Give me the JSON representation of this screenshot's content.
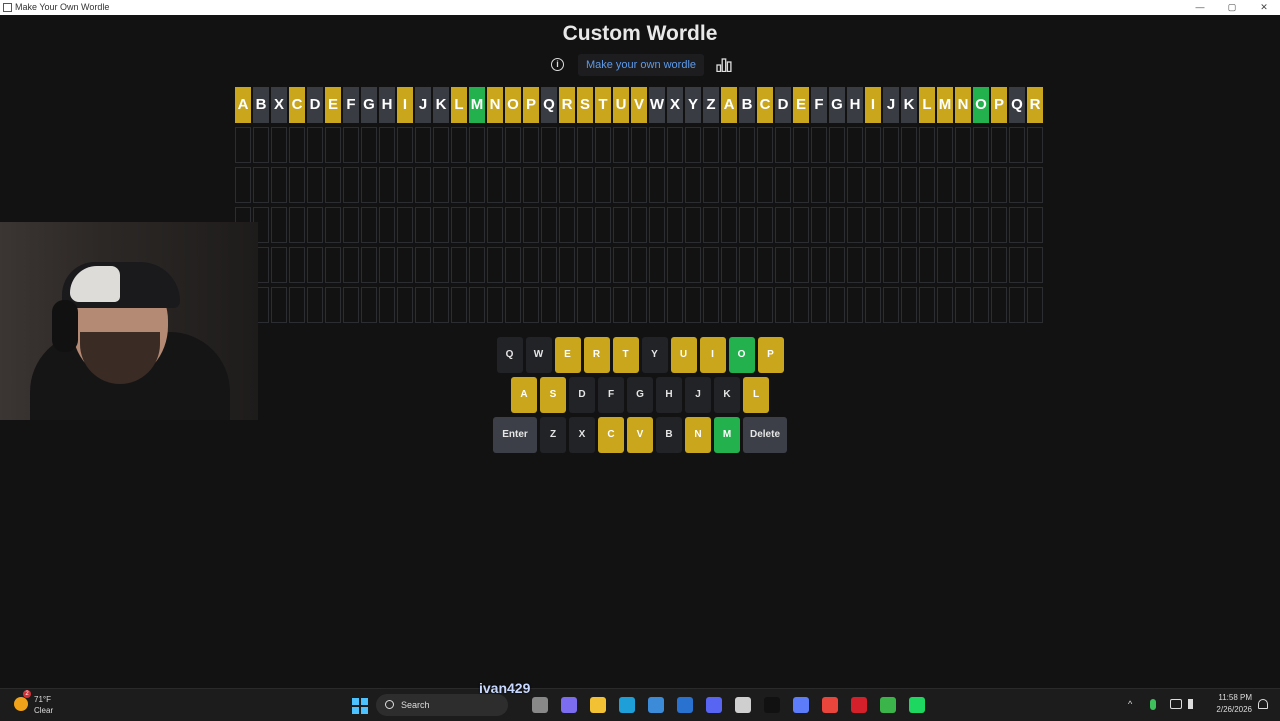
{
  "window": {
    "title": "Make Your Own Wordle",
    "controls": [
      "—",
      "▢",
      "✕"
    ]
  },
  "header": {
    "title": "Custom Wordle",
    "link_label": "Make your own wordle",
    "info_icon": "info-icon",
    "stats_icon": "stats-icon"
  },
  "colors": {
    "correct": "#22b14c",
    "present": "#c9a61c",
    "absent": "#3a3c43",
    "background": "#121213",
    "link": "#5e9ae8"
  },
  "board": {
    "columns": 45,
    "empty_rows": 5,
    "guess_row": [
      {
        "letter": "A",
        "state": "present"
      },
      {
        "letter": "B",
        "state": "absent"
      },
      {
        "letter": "X",
        "state": "absent"
      },
      {
        "letter": "C",
        "state": "present"
      },
      {
        "letter": "D",
        "state": "absent"
      },
      {
        "letter": "E",
        "state": "present"
      },
      {
        "letter": "F",
        "state": "absent"
      },
      {
        "letter": "G",
        "state": "absent"
      },
      {
        "letter": "H",
        "state": "absent"
      },
      {
        "letter": "I",
        "state": "present"
      },
      {
        "letter": "J",
        "state": "absent"
      },
      {
        "letter": "K",
        "state": "absent"
      },
      {
        "letter": "L",
        "state": "present"
      },
      {
        "letter": "M",
        "state": "correct"
      },
      {
        "letter": "N",
        "state": "present"
      },
      {
        "letter": "O",
        "state": "present"
      },
      {
        "letter": "P",
        "state": "present"
      },
      {
        "letter": "Q",
        "state": "absent"
      },
      {
        "letter": "R",
        "state": "present"
      },
      {
        "letter": "S",
        "state": "present"
      },
      {
        "letter": "T",
        "state": "present"
      },
      {
        "letter": "U",
        "state": "present"
      },
      {
        "letter": "V",
        "state": "present"
      },
      {
        "letter": "W",
        "state": "absent"
      },
      {
        "letter": "X",
        "state": "absent"
      },
      {
        "letter": "Y",
        "state": "absent"
      },
      {
        "letter": "Z",
        "state": "absent"
      },
      {
        "letter": "A",
        "state": "present"
      },
      {
        "letter": "B",
        "state": "absent"
      },
      {
        "letter": "C",
        "state": "present"
      },
      {
        "letter": "D",
        "state": "absent"
      },
      {
        "letter": "E",
        "state": "present"
      },
      {
        "letter": "F",
        "state": "absent"
      },
      {
        "letter": "G",
        "state": "absent"
      },
      {
        "letter": "H",
        "state": "absent"
      },
      {
        "letter": "I",
        "state": "present"
      },
      {
        "letter": "J",
        "state": "absent"
      },
      {
        "letter": "K",
        "state": "absent"
      },
      {
        "letter": "L",
        "state": "present"
      },
      {
        "letter": "M",
        "state": "present"
      },
      {
        "letter": "N",
        "state": "present"
      },
      {
        "letter": "O",
        "state": "correct"
      },
      {
        "letter": "P",
        "state": "present"
      },
      {
        "letter": "Q",
        "state": "absent"
      },
      {
        "letter": "R",
        "state": "present"
      }
    ]
  },
  "keyboard": {
    "rows": [
      [
        {
          "key": "Q",
          "state": "default"
        },
        {
          "key": "W",
          "state": "default"
        },
        {
          "key": "E",
          "state": "present"
        },
        {
          "key": "R",
          "state": "present"
        },
        {
          "key": "T",
          "state": "present"
        },
        {
          "key": "Y",
          "state": "default"
        },
        {
          "key": "U",
          "state": "present"
        },
        {
          "key": "I",
          "state": "present"
        },
        {
          "key": "O",
          "state": "correct"
        },
        {
          "key": "P",
          "state": "present"
        }
      ],
      [
        {
          "key": "A",
          "state": "present"
        },
        {
          "key": "S",
          "state": "present"
        },
        {
          "key": "D",
          "state": "default"
        },
        {
          "key": "F",
          "state": "default"
        },
        {
          "key": "G",
          "state": "default"
        },
        {
          "key": "H",
          "state": "default"
        },
        {
          "key": "J",
          "state": "default"
        },
        {
          "key": "K",
          "state": "default"
        },
        {
          "key": "L",
          "state": "present"
        }
      ],
      [
        {
          "key": "Enter",
          "state": "wide"
        },
        {
          "key": "Z",
          "state": "default"
        },
        {
          "key": "X",
          "state": "default"
        },
        {
          "key": "C",
          "state": "present"
        },
        {
          "key": "V",
          "state": "present"
        },
        {
          "key": "B",
          "state": "default"
        },
        {
          "key": "N",
          "state": "present"
        },
        {
          "key": "M",
          "state": "correct"
        },
        {
          "key": "Delete",
          "state": "wide"
        }
      ]
    ]
  },
  "overlay": {
    "username": "ivan429"
  },
  "taskbar": {
    "weather": {
      "temp": "71°F",
      "condition": "Clear",
      "badge": "2"
    },
    "search_label": "Search",
    "apps": [
      {
        "name": "task-view-icon",
        "color": "#888888"
      },
      {
        "name": "copilot-icon",
        "color": "#7b6cf0"
      },
      {
        "name": "file-explorer-icon",
        "color": "#f3c234"
      },
      {
        "name": "edge-icon",
        "color": "#1f9fd8"
      },
      {
        "name": "store-icon",
        "color": "#3c8bd9"
      },
      {
        "name": "outlook-icon",
        "color": "#2a72d0"
      },
      {
        "name": "discord-icon",
        "color": "#5865f2"
      },
      {
        "name": "obs-icon",
        "color": "#cfcfcf"
      },
      {
        "name": "tiktok-icon",
        "color": "#111111"
      },
      {
        "name": "app-icon",
        "color": "#5c7cfa"
      },
      {
        "name": "chrome-icon",
        "color": "#e8453c"
      },
      {
        "name": "adobe-icon",
        "color": "#d4202a"
      },
      {
        "name": "media-icon",
        "color": "#3bb54a"
      },
      {
        "name": "spotify-icon",
        "color": "#1ed760"
      }
    ],
    "time": "11:58 PM",
    "date": "2/26/2026"
  }
}
